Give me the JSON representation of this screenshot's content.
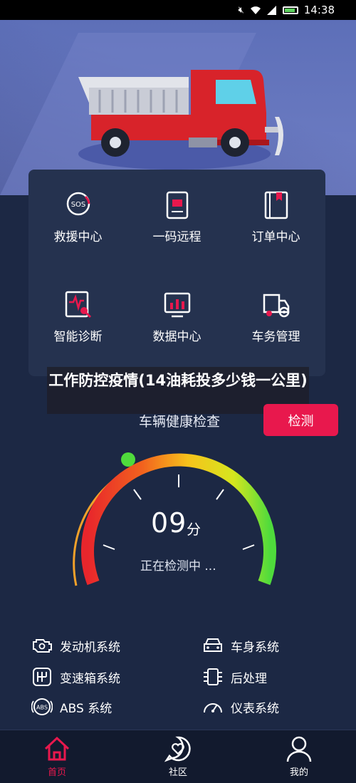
{
  "status_bar": {
    "time": "14:38"
  },
  "overlay": {
    "title": "工作防控疫情(14油耗投多少钱一公里)"
  },
  "grid": {
    "items": [
      {
        "label": "救援中心",
        "icon": "sos-icon"
      },
      {
        "label": "一码远程",
        "icon": "qr-document-icon"
      },
      {
        "label": "订单中心",
        "icon": "order-book-icon"
      },
      {
        "label": "智能诊断",
        "icon": "diagnosis-icon"
      },
      {
        "label": "数据中心",
        "icon": "data-screen-icon"
      },
      {
        "label": "车务管理",
        "icon": "truck-gear-icon"
      }
    ]
  },
  "health": {
    "label": "车辆健康检查",
    "button": "检测",
    "score": "09",
    "unit": "分",
    "status": "正在检测中 ..."
  },
  "systems": [
    {
      "label": "发动机系统",
      "icon": "engine-icon"
    },
    {
      "label": "车身系统",
      "icon": "car-body-icon"
    },
    {
      "label": "变速箱系统",
      "icon": "gearbox-icon"
    },
    {
      "label": "后处理",
      "icon": "exhaust-icon"
    },
    {
      "label": "ABS 系统",
      "icon": "abs-icon"
    },
    {
      "label": "仪表系统",
      "icon": "gauge-icon"
    }
  ],
  "tabs": [
    {
      "label": "首页",
      "icon": "home-icon",
      "active": true
    },
    {
      "label": "社区",
      "icon": "community-icon",
      "active": false
    },
    {
      "label": "我的",
      "icon": "profile-icon",
      "active": false
    }
  ],
  "colors": {
    "accent": "#e8184d",
    "background": "#1c2844",
    "card": "#25324f",
    "hero": "#6675bd"
  }
}
